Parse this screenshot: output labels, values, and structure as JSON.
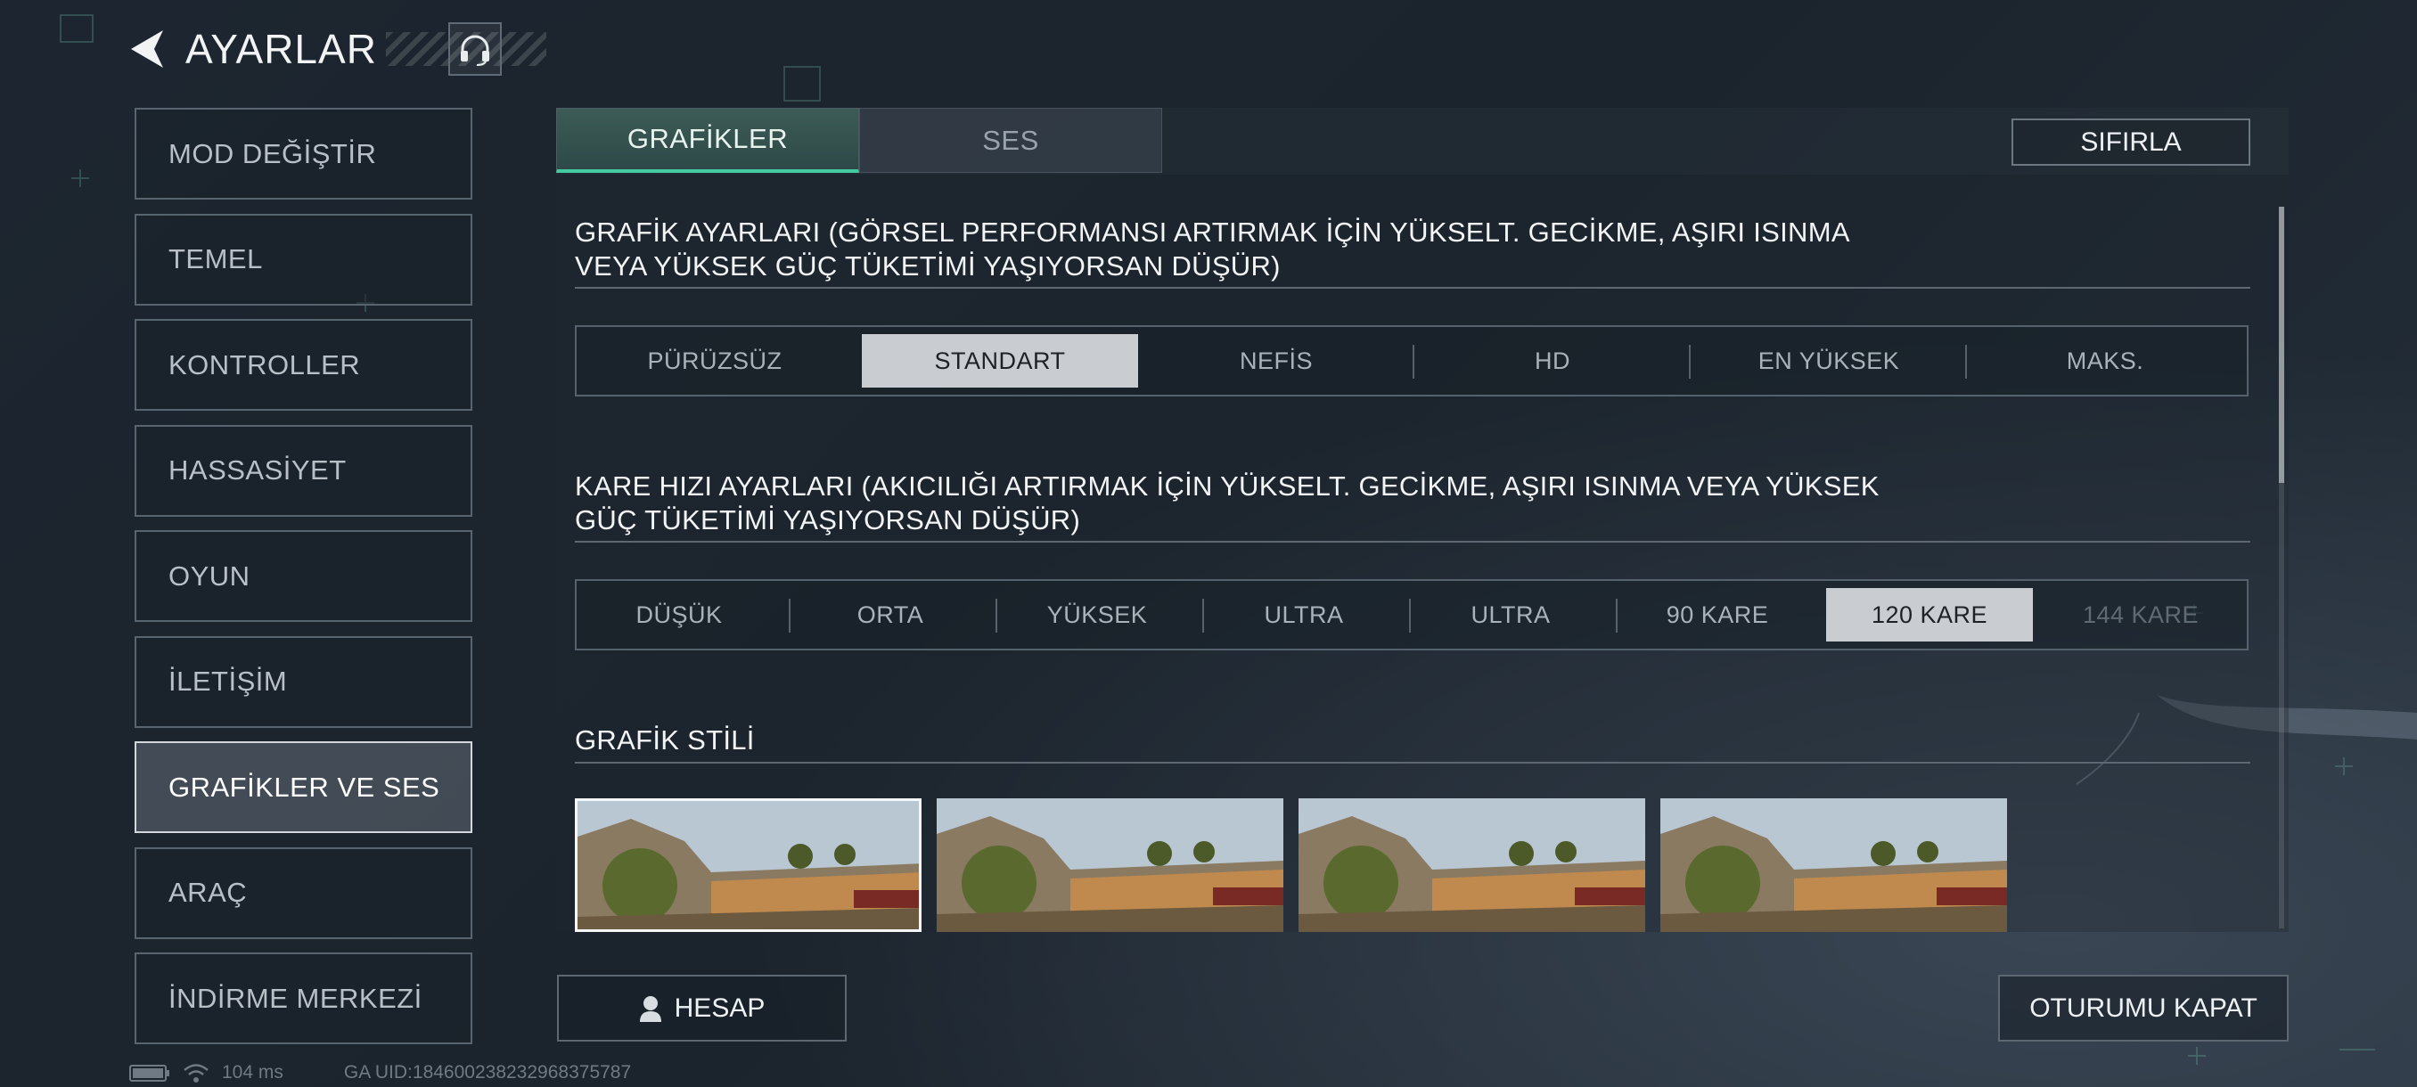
{
  "header": {
    "title": "AYARLAR",
    "back_icon": "back-arrow-icon",
    "headset_icon": "headset-icon"
  },
  "sidebar": {
    "items": [
      {
        "label": "MOD DEĞİŞTİR"
      },
      {
        "label": "TEMEL"
      },
      {
        "label": "KONTROLLER"
      },
      {
        "label": "HASSASİYET"
      },
      {
        "label": "OYUN"
      },
      {
        "label": "İLETİŞİM"
      },
      {
        "label": "GRAFİKLER VE SES",
        "active": true
      },
      {
        "label": "ARAÇ"
      },
      {
        "label": "İNDİRME MERKEZİ"
      }
    ]
  },
  "tabs": [
    {
      "label": "GRAFİKLER",
      "active": true
    },
    {
      "label": "SES"
    }
  ],
  "reset_label": "SIFIRLA",
  "graphics_settings": {
    "title_line1": "GRAFİK AYARLARI (GÖRSEL PERFORMANSI ARTIRMAK İÇİN YÜKSELT. GECİKME, AŞIRI ISINMA",
    "title_line2": "VEYA YÜKSEK GÜÇ TÜKETİMİ YAŞIYORSAN DÜŞÜR)",
    "options": [
      "PÜRÜZSÜZ",
      "STANDART",
      "NEFİS",
      "HD",
      "EN YÜKSEK",
      "MAKS."
    ],
    "selected": "STANDART"
  },
  "frame_rate_settings": {
    "title_line1": "KARE HIZI AYARLARI (AKICILIĞI ARTIRMAK İÇİN YÜKSELT. GECİKME, AŞIRI ISINMA VEYA YÜKSEK",
    "title_line2": "GÜÇ TÜKETİMİ YAŞIYORSAN DÜŞÜR)",
    "options": [
      "DÜŞÜK",
      "ORTA",
      "YÜKSEK",
      "ULTRA",
      "ULTRA",
      "90 KARE",
      "120 KARE",
      "144 KARE"
    ],
    "selected": "120 KARE",
    "disabled": [
      "144 KARE"
    ]
  },
  "graphics_style": {
    "title": "GRAFİK STİLİ",
    "selected_index": 0
  },
  "account_label": "HESAP",
  "logout_label": "OTURUMU KAPAT",
  "status": {
    "ping": "104 ms",
    "uid": "GA UID:18460023823296837578​7"
  },
  "colors": {
    "accent": "#44c9a1",
    "selected_option_bg": "#c9cdd1",
    "background": "#1d2630"
  }
}
